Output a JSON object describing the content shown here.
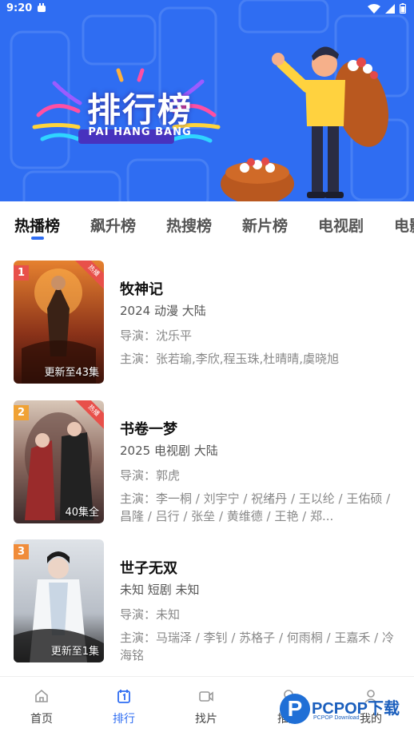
{
  "status_bar": {
    "time": "9:20"
  },
  "banner": {
    "title": "排行榜",
    "subtitle": "PAI HANG BANG"
  },
  "tabs": [
    {
      "label": "热播榜",
      "active": true
    },
    {
      "label": "飙升榜"
    },
    {
      "label": "热搜榜"
    },
    {
      "label": "新片榜"
    },
    {
      "label": "电视剧"
    },
    {
      "label": "电影"
    }
  ],
  "list": [
    {
      "rank": "1",
      "rank_color": "#e8504a",
      "hot_tag": "热播",
      "episode": "更新至43集",
      "title": "牧神记",
      "meta": "2024  动漫  大陆",
      "director": "导演：沈乐平",
      "cast": "主演：张若瑜,李欣,程玉珠,杜晴晴,虞晓旭"
    },
    {
      "rank": "2",
      "rank_color": "#f0a235",
      "hot_tag": "热播",
      "episode": "40集全",
      "title": "书卷一梦",
      "meta": "2025  电视剧  大陆",
      "director": "导演：郭虎",
      "cast": "主演：李一桐 / 刘宇宁 / 祝绪丹 / 王以纶 / 王佑硕 / 昌隆 / 吕行 / 张垒 / 黄维德 / 王艳 / 郑..."
    },
    {
      "rank": "3",
      "rank_color": "#f08c3a",
      "hot_tag": "",
      "episode": "更新至1集",
      "title": "世子无双",
      "meta": "未知  短剧  未知",
      "director": "导演：未知",
      "cast": "主演：马瑞泽 / 李钊 / 苏格子 / 何雨桐 / 王嘉禾 / 冷海铭"
    }
  ],
  "bottom_nav": [
    {
      "label": "首页",
      "icon": "home-icon"
    },
    {
      "label": "排行",
      "icon": "ranking-icon",
      "active": true
    },
    {
      "label": "找片",
      "icon": "video-icon"
    },
    {
      "label": "推广",
      "icon": "share-icon"
    },
    {
      "label": "我的",
      "icon": "user-icon"
    }
  ],
  "watermark": {
    "logo": "P",
    "text": "PCPOP下载",
    "small": "PCPOP Download"
  },
  "colors": {
    "accent": "#2f6df2",
    "banner_bg": "#2f6df2"
  }
}
